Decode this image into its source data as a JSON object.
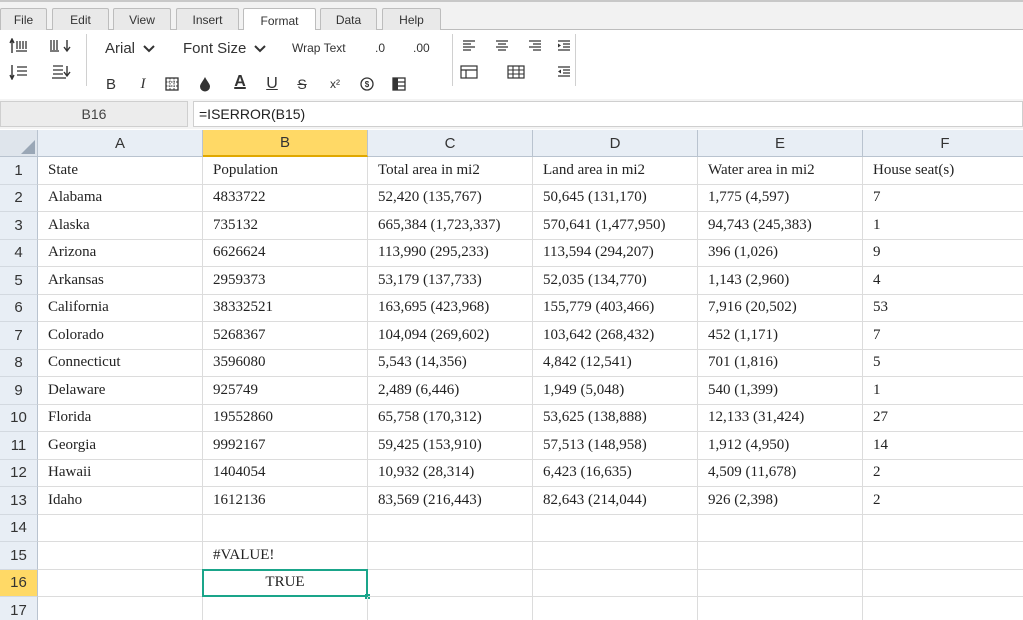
{
  "menu": {
    "tabs": [
      "File",
      "Edit",
      "View",
      "Insert",
      "Format",
      "Data",
      "Help"
    ],
    "active": "Format"
  },
  "toolbar": {
    "font_name": "Arial",
    "font_size_label": "Font Size",
    "wrap_text": "Wrap Text",
    "decrease_decimal": ".0",
    "increase_decimal": ".00",
    "bold": "B",
    "italic": "I",
    "underline": "U",
    "strikethrough": "S",
    "superscript": "x²",
    "font_color_letter": "A",
    "currency": "$",
    "accent_color": "#1aa58a"
  },
  "formula_bar": {
    "cell_ref": "B16",
    "formula": "=ISERROR(B15)"
  },
  "sheet": {
    "columns": [
      "A",
      "B",
      "C",
      "D",
      "E",
      "F"
    ],
    "selected_column": "B",
    "rows": [
      "1",
      "2",
      "3",
      "4",
      "5",
      "6",
      "7",
      "8",
      "9",
      "10",
      "11",
      "12",
      "13",
      "14",
      "15",
      "16",
      "17"
    ],
    "selected_row": "16",
    "cells": [
      [
        "State",
        "Population",
        "Total area in mi2",
        "Land area in mi2",
        "Water area in mi2",
        "House seat(s)"
      ],
      [
        "Alabama",
        "4833722",
        "52,420 (135,767)",
        "50,645 (131,170)",
        "1,775 (4,597)",
        "7"
      ],
      [
        "Alaska",
        "735132",
        "665,384 (1,723,337)",
        "570,641 (1,477,950)",
        "94,743 (245,383)",
        "1"
      ],
      [
        "Arizona",
        "6626624",
        "113,990 (295,233)",
        "113,594 (294,207)",
        "396 (1,026)",
        "9"
      ],
      [
        "Arkansas",
        "2959373",
        "53,179 (137,733)",
        "52,035 (134,770)",
        "1,143 (2,960)",
        "4"
      ],
      [
        "California",
        "38332521",
        "163,695 (423,968)",
        "155,779 (403,466)",
        "7,916 (20,502)",
        "53"
      ],
      [
        "Colorado",
        "5268367",
        "104,094 (269,602)",
        "103,642 (268,432)",
        "452 (1,171)",
        "7"
      ],
      [
        "Connecticut",
        "3596080",
        "5,543 (14,356)",
        "4,842 (12,541)",
        "701 (1,816)",
        "5"
      ],
      [
        "Delaware",
        "925749",
        "2,489 (6,446)",
        "1,949 (5,048)",
        "540 (1,399)",
        "1"
      ],
      [
        "Florida",
        "19552860",
        "65,758 (170,312)",
        "53,625 (138,888)",
        "12,133 (31,424)",
        "27"
      ],
      [
        "Georgia",
        "9992167",
        "59,425 (153,910)",
        "57,513 (148,958)",
        "1,912 (4,950)",
        "14"
      ],
      [
        "Hawaii",
        "1404054",
        "10,932 (28,314)",
        "6,423 (16,635)",
        "4,509 (11,678)",
        "2"
      ],
      [
        "Idaho",
        "1612136",
        "83,569 (216,443)",
        "82,643 (214,044)",
        "926 (2,398)",
        "2"
      ],
      [
        "",
        "",
        "",
        "",
        "",
        ""
      ],
      [
        "",
        "#VALUE!",
        "",
        "",
        "",
        ""
      ],
      [
        "",
        "TRUE",
        "",
        "",
        "",
        ""
      ],
      [
        "",
        "",
        "",
        "",
        "",
        ""
      ]
    ]
  }
}
